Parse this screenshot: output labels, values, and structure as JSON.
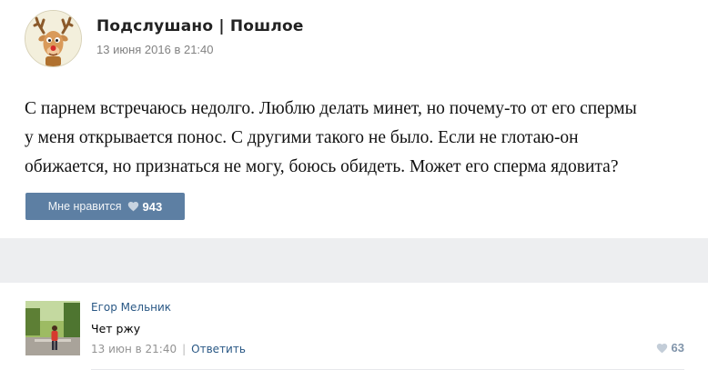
{
  "post": {
    "group_name": "Подслушано | Пошлое",
    "date": "13 июня 2016 в 21:40",
    "text_lines": [
      "С парнем встречаюсь недолго. Люблю делать минет, но почему-то от его спермы",
      "у меня открывается понос. С другими такого не было. Если не глотаю-он",
      "обижается, но признаться не могу, боюсь обидеть. Может его сперма ядовита?"
    ],
    "like_label": "Мне нравится",
    "like_count": "943",
    "like_icon": "heart-icon"
  },
  "comment": {
    "author": "Егор Мельник",
    "text": "Чет ржу",
    "date": "13 июн в 21:40",
    "separator": "|",
    "reply_label": "Ответить",
    "like_count": "63",
    "like_icon": "heart-icon"
  },
  "colors": {
    "background": "#edeef0",
    "card": "#ffffff",
    "like_button": "#5d7fa3",
    "link": "#2a5885",
    "meta_text": "#828282"
  }
}
